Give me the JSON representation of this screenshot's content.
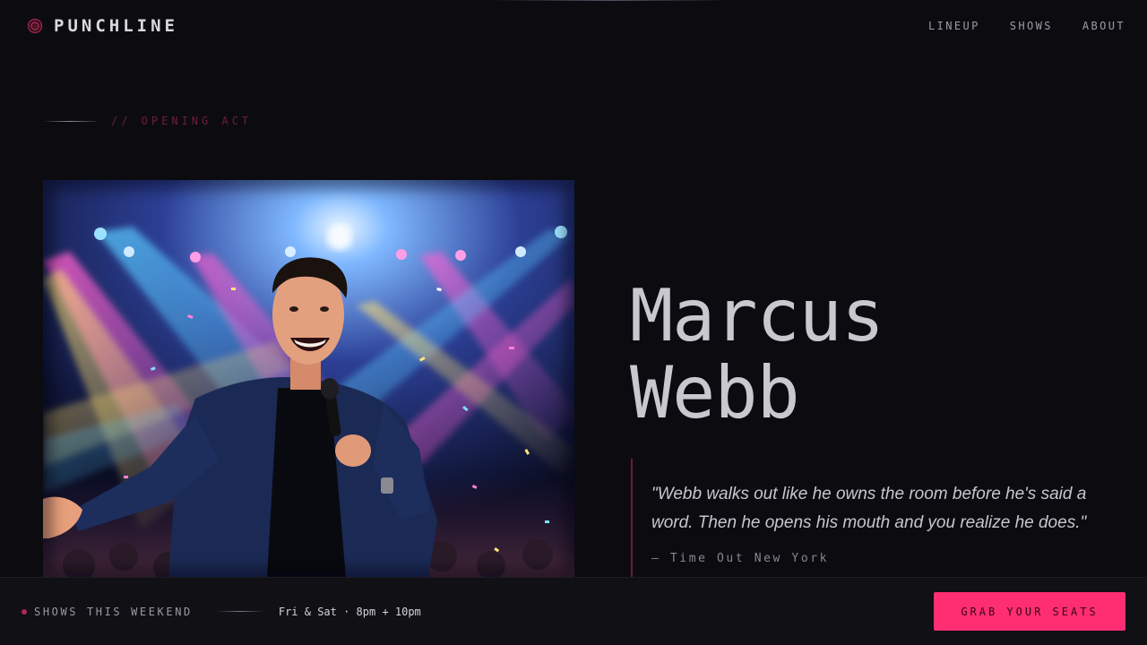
{
  "app": {
    "brand": "PUNCHLINE",
    "logo_icon": "disco-ball-icon",
    "accent_color": "#ff2e73"
  },
  "nav": {
    "items": [
      {
        "label": "LINEUP"
      },
      {
        "label": "SHOWS"
      },
      {
        "label": "ABOUT"
      }
    ]
  },
  "section": {
    "eyebrow": "// OPENING ACT"
  },
  "performer": {
    "first_name": "Marcus",
    "last_name": "Webb",
    "photo": "comedian-on-stage-photo"
  },
  "review": {
    "quote": "\"Webb walks out like he owns the room before he's said a word. Then he opens his mouth and you realize he does.\"",
    "source": "— Time Out New York"
  },
  "footer": {
    "label": "SHOWS THIS WEEKEND",
    "times": "Fri & Sat · 8pm + 10pm",
    "cta_label": "GRAB YOUR SEATS"
  }
}
